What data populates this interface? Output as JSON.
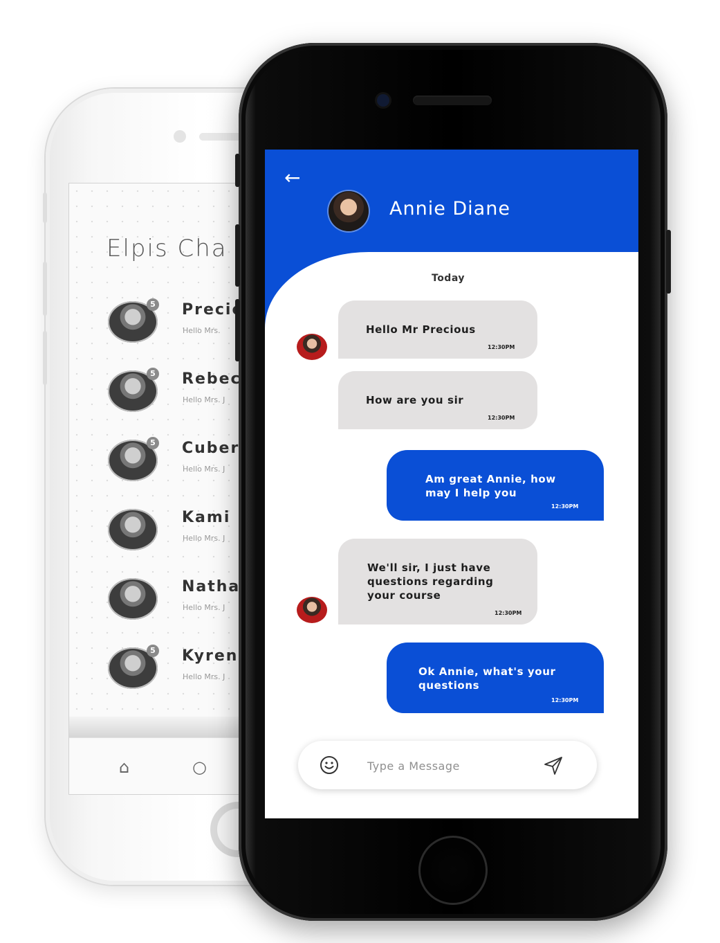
{
  "back_phone": {
    "title": "Elpis Cha",
    "contacts": [
      {
        "name": "Precio",
        "preview": "Hello Mrs.",
        "badge": "5"
      },
      {
        "name": "Rebec",
        "preview": "Hello Mrs. J",
        "badge": "5"
      },
      {
        "name": "Cuber",
        "preview": "Hello Mrs. J",
        "badge": "5"
      },
      {
        "name": "Kami",
        "preview": "Hello Mrs. J",
        "badge": ""
      },
      {
        "name": "Natha",
        "preview": "Hello Mrs. J",
        "badge": ""
      },
      {
        "name": "Kyren",
        "preview": "Hello Mrs. J",
        "badge": "5"
      }
    ],
    "nav_icons": {
      "home": "⌂",
      "search": "○"
    }
  },
  "chat": {
    "back_icon": "←",
    "contact_name": "Annie Diane",
    "date_label": "Today",
    "messages": [
      {
        "text": "Hello Mr Precious",
        "time": "12:30PM"
      },
      {
        "text": "How are you sir",
        "time": "12:30PM"
      },
      {
        "text": "Am great Annie, how\nmay I help you",
        "time": "12:30PM"
      },
      {
        "text": "We'll sir, I just have\nquestions regarding\nyour course",
        "time": "12:30PM"
      },
      {
        "text": "Ok Annie, what's your\nquestions",
        "time": "12:30PM"
      }
    ],
    "input_placeholder": "Type a Message"
  },
  "colors": {
    "accent": "#0a4fd6",
    "incoming_bubble": "#e3e1e1",
    "outgoing_bubble": "#0a4fd6"
  },
  "icons": [
    "arrow-left-icon",
    "smiley-icon",
    "send-icon",
    "home-icon",
    "search-icon"
  ]
}
